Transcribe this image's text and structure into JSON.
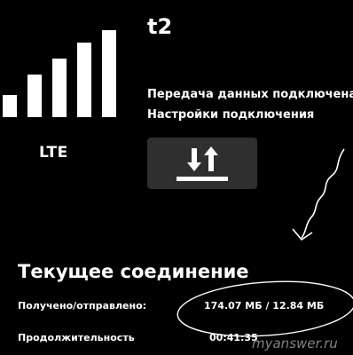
{
  "signal": {
    "network_type": "LTE",
    "bars_filled": 5,
    "bars_total": 5
  },
  "connection": {
    "operator": "t2",
    "status_transfer": "Передача данных подключена",
    "status_settings": "Настройки подключения",
    "data_toggle_icon": "data-transfer-icon"
  },
  "current_connection": {
    "title": "Текущее соединение",
    "rows": [
      {
        "label": "Получено/отправлено:",
        "value": "174.07 МБ / 12.84 МБ"
      },
      {
        "label": "Продолжительность",
        "value": "00:41:35"
      }
    ]
  },
  "watermark": "myanswer.ru",
  "colors": {
    "background": "#000000",
    "text": "#ffffff",
    "button": "#2f2f2f"
  }
}
